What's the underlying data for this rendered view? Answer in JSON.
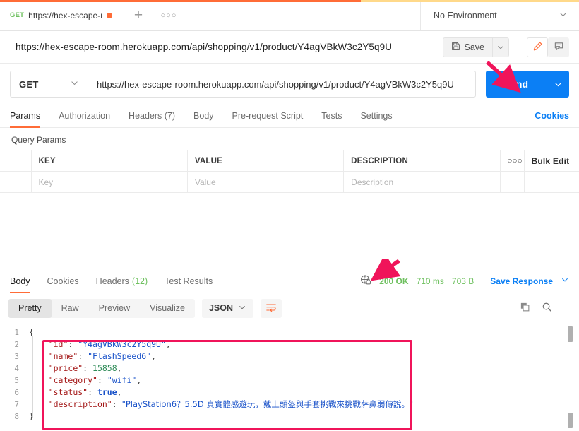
{
  "tabbar": {
    "tab": {
      "method": "GET",
      "name": "https://hex-escape-roo",
      "unsaved_icon": "unsaved-dot"
    },
    "new_tab_label": "+",
    "more_label": "○○○",
    "environment": {
      "selected": "No Environment",
      "chevron": "chevron-down-icon"
    }
  },
  "title": {
    "url": "https://hex-escape-room.herokuapp.com/api/shopping/v1/product/Y4agVBkW3c2Y5q9U",
    "save_label": "Save",
    "save_icon": "floppy-disk-icon",
    "save_caret": "chevron-down-icon",
    "edit_icon": "pencil-icon",
    "comment_icon": "comment-icon"
  },
  "request": {
    "method": "GET",
    "method_chevron": "chevron-down-icon",
    "url": "https://hex-escape-room.herokuapp.com/api/shopping/v1/product/Y4agVBkW3c2Y5q9U",
    "send_label": "Send",
    "send_caret": "chevron-down-icon"
  },
  "request_tabs": {
    "items": [
      {
        "label": "Params",
        "active": true
      },
      {
        "label": "Authorization",
        "active": false
      },
      {
        "label": "Headers (7)",
        "active": false
      },
      {
        "label": "Body",
        "active": false
      },
      {
        "label": "Pre-request Script",
        "active": false
      },
      {
        "label": "Tests",
        "active": false
      },
      {
        "label": "Settings",
        "active": false
      }
    ],
    "cookies_label": "Cookies"
  },
  "params": {
    "section_label": "Query Params",
    "columns": [
      "KEY",
      "VALUE",
      "DESCRIPTION"
    ],
    "more_icon": "○○○",
    "bulk_edit_label": "Bulk Edit",
    "empty_row": {
      "key_placeholder": "Key",
      "value_placeholder": "Value",
      "description_placeholder": "Description"
    }
  },
  "response_tabs": {
    "items": [
      {
        "label": "Body",
        "active": true,
        "count": ""
      },
      {
        "label": "Cookies",
        "active": false,
        "count": ""
      },
      {
        "label": "Headers",
        "active": false,
        "count": "(12)"
      },
      {
        "label": "Test Results",
        "active": false,
        "count": ""
      }
    ]
  },
  "response_meta": {
    "secure_icon": "globe-lock-icon",
    "status": "200 OK",
    "time": "710 ms",
    "size": "703 B",
    "save_response_label": "Save Response",
    "save_response_caret": "chevron-down-icon"
  },
  "body_toolbar": {
    "views": [
      {
        "label": "Pretty",
        "active": true
      },
      {
        "label": "Raw",
        "active": false
      },
      {
        "label": "Preview",
        "active": false
      },
      {
        "label": "Visualize",
        "active": false
      }
    ],
    "format": "JSON",
    "format_caret": "chevron-down-icon",
    "wrap_icon": "wrap-lines-icon",
    "copy_icon": "copy-icon",
    "search_icon": "search-icon"
  },
  "response_body": {
    "line_numbers": [
      "1",
      "2",
      "3",
      "4",
      "5",
      "6",
      "7",
      "8"
    ],
    "open_brace": "{",
    "close_brace": "}",
    "fields": [
      {
        "key": "\"id\"",
        "value": "\"Y4agVBkW3c2Y5q9U\"",
        "type": "string",
        "comma": ","
      },
      {
        "key": "\"name\"",
        "value": "\"FlashSpeed6\"",
        "type": "string",
        "comma": ","
      },
      {
        "key": "\"price\"",
        "value": "15858",
        "type": "number",
        "comma": ","
      },
      {
        "key": "\"category\"",
        "value": "\"wifi\"",
        "type": "string",
        "comma": ","
      },
      {
        "key": "\"status\"",
        "value": "true",
        "type": "boolean",
        "comma": ","
      },
      {
        "key": "\"description\"",
        "value": "\"PlayStation6？5.5D 真實體感遊玩，戴上頭盔與手套挑戰來挑戰萨鼻弱傳說。\"",
        "type": "string",
        "comma": ""
      }
    ]
  },
  "annotations": {
    "arrow_send": "red-arrow-pointing-to-send-button",
    "arrow_status": "red-arrow-pointing-to-status",
    "highlight_box_color": "#f0145a"
  },
  "colors": {
    "accent_orange": "#ff6c37",
    "send_blue": "#0b7ff5",
    "status_green": "#6ec05f",
    "highlight_pink": "#f0145a"
  }
}
